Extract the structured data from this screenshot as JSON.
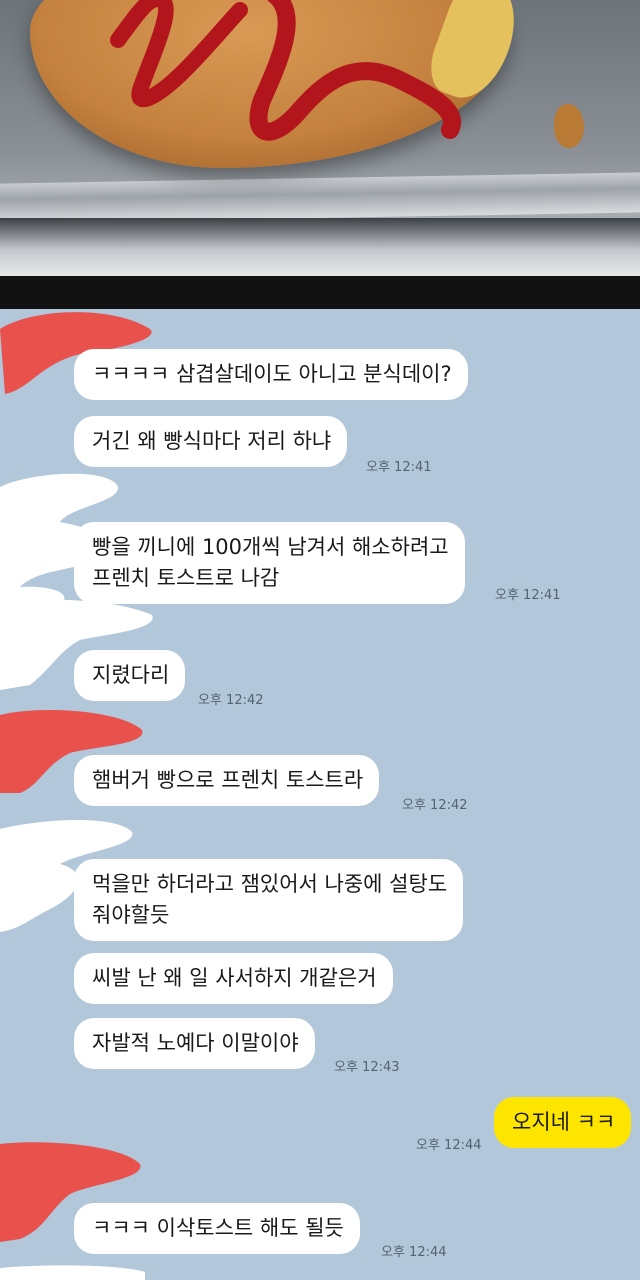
{
  "colors": {
    "chat_background": "#b2c7d9",
    "incoming_bubble": "#ffffff",
    "outgoing_bubble": "#fee500",
    "redaction_red": "#e8514c",
    "redaction_white": "#ffffff"
  },
  "photo": {
    "icon": "food-photo-icon"
  },
  "messages": [
    {
      "text": "ㅋㅋㅋㅋ 삼겹살데이도 아니고 분식데이?",
      "side": "incoming"
    },
    {
      "text": "거긴 왜 빵식마다 저리 하냐",
      "time": "오후 12:41",
      "side": "incoming"
    },
    {
      "lines": [
        "빵을 끼니에 100개씩 남겨서 해소하려고",
        "프렌치 토스트로 나감"
      ],
      "time": "오후 12:41",
      "side": "incoming"
    },
    {
      "text": "지렸다리",
      "time": "오후 12:42",
      "side": "incoming"
    },
    {
      "text": "햄버거 빵으로 프렌치 토스트라",
      "time": "오후 12:42",
      "side": "incoming"
    },
    {
      "lines": [
        "먹을만 하더라고 잼있어서 나중에 설탕도",
        "줘야할듯"
      ],
      "side": "incoming"
    },
    {
      "text": "씨발 난 왜 일 사서하지 개같은거",
      "side": "incoming"
    },
    {
      "text": "자발적 노예다 이말이야",
      "time": "오후 12:43",
      "side": "incoming"
    },
    {
      "text": "오지네 ㅋㅋ",
      "time": "오후 12:44",
      "side": "outgoing"
    },
    {
      "text": "ㅋㅋㅋ 이삭토스트 해도 될듯",
      "time": "오후 12:44",
      "side": "incoming"
    }
  ]
}
